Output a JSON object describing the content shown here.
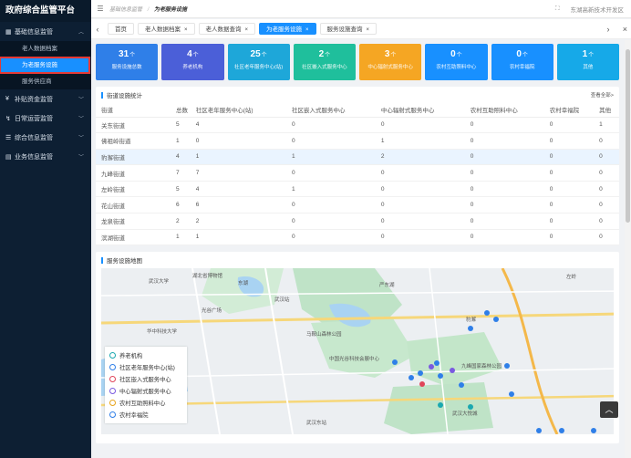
{
  "app": {
    "title": "政府综合监管平台"
  },
  "sidebar": {
    "groups": [
      {
        "label": "基础信息监管",
        "icon": "grid-icon",
        "expanded": true,
        "items": [
          {
            "label": "老人数据档案"
          },
          {
            "label": "为老服务设施"
          },
          {
            "label": "服务供应商"
          }
        ]
      },
      {
        "label": "补贴资金监管",
        "icon": "money-icon"
      },
      {
        "label": "日常运营监管",
        "icon": "pulse-icon"
      },
      {
        "label": "综合信息监管",
        "icon": "list-icon"
      },
      {
        "label": "业务信息监管",
        "icon": "chart-icon"
      }
    ]
  },
  "header": {
    "breadcrumb": [
      "基础信息监管",
      "为老服务设施"
    ],
    "region": "东湖高新技术开发区"
  },
  "tabs": [
    {
      "label": "首页"
    },
    {
      "label": "老人数据档案"
    },
    {
      "label": "老人数据查询"
    },
    {
      "label": "为老服务设施",
      "active": true
    },
    {
      "label": "服务设施查询"
    }
  ],
  "cards": [
    {
      "value": "31",
      "unit": "个",
      "label": "服务设施总数",
      "color": "#2f7fe8"
    },
    {
      "value": "4",
      "unit": "个",
      "label": "养老机构",
      "color": "#4b5fd8"
    },
    {
      "value": "25",
      "unit": "个",
      "label": "社区老年服务中心(站)",
      "color": "#1ea7d9"
    },
    {
      "value": "2",
      "unit": "个",
      "label": "社区嵌入式服务中心",
      "color": "#1fbf9c"
    },
    {
      "value": "3",
      "unit": "个",
      "label": "中心辐射式服务中心",
      "color": "#f5a623"
    },
    {
      "value": "0",
      "unit": "个",
      "label": "农村互助照料中心",
      "color": "#1890ff"
    },
    {
      "value": "0",
      "unit": "个",
      "label": "农村幸福院",
      "color": "#1890ff"
    },
    {
      "value": "1",
      "unit": "个",
      "label": "其他",
      "color": "#16a9e8"
    }
  ],
  "stats": {
    "title": "街道设施统计",
    "more": "查看全部>",
    "headers": [
      "街道",
      "总数",
      "社区老年服务中心(站)",
      "社区嵌入式服务中心",
      "中心辐射式服务中心",
      "农村互助照料中心",
      "农村幸福院",
      "其他"
    ],
    "rows": [
      [
        "关东街道",
        "5",
        "4",
        "0",
        "0",
        "0",
        "0",
        "1"
      ],
      [
        "佛祖岭街道",
        "1",
        "0",
        "0",
        "1",
        "0",
        "0",
        "0"
      ],
      [
        "豹澥街道",
        "4",
        "1",
        "1",
        "2",
        "0",
        "0",
        "0"
      ],
      [
        "九峰街道",
        "7",
        "7",
        "0",
        "0",
        "0",
        "0",
        "0"
      ],
      [
        "左岭街道",
        "5",
        "4",
        "1",
        "0",
        "0",
        "0",
        "0"
      ],
      [
        "花山街道",
        "6",
        "6",
        "0",
        "0",
        "0",
        "0",
        "0"
      ],
      [
        "龙泉街道",
        "2",
        "2",
        "0",
        "0",
        "0",
        "0",
        "0"
      ],
      [
        "滨湖街道",
        "1",
        "1",
        "0",
        "0",
        "0",
        "0",
        "0"
      ]
    ],
    "highlight_row": 2
  },
  "map": {
    "title": "服务设施地图",
    "legend": [
      {
        "label": "养老机构",
        "color": "#1ba8b0"
      },
      {
        "label": "社区老年服务中心(站)",
        "color": "#2f7fe8"
      },
      {
        "label": "社区嵌入式服务中心",
        "color": "#e0455a"
      },
      {
        "label": "中心辐射式服务中心",
        "color": "#7a5ae0"
      },
      {
        "label": "农村互助照料中心",
        "color": "#e8a31a"
      },
      {
        "label": "农村幸福院",
        "color": "#2f7fe8"
      }
    ],
    "labels": [
      "武汉大学",
      "南湖",
      "东湖",
      "华中科技大学",
      "武汉东站",
      "武汉大悦城",
      "九峰国家森林公园",
      "光谷广场",
      "马鞍山森林公园",
      "严东湖",
      "中国光谷科技会展中心",
      "豹澥",
      "左岭",
      "武汉站",
      "湖北省博物馆"
    ]
  },
  "colors": {
    "sidebar_bg": "#0d1f33",
    "accent": "#1890ff",
    "active_outline": "#e53935"
  }
}
